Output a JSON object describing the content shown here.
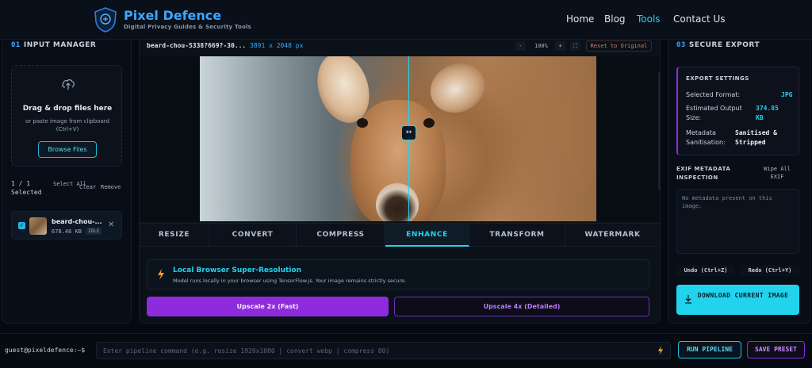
{
  "header": {
    "brand_name": "Pixel Defence",
    "brand_tagline": "Digital Privacy Guides & Security Tools",
    "nav": [
      {
        "label": "Home"
      },
      {
        "label": "Blog"
      },
      {
        "label": "Tools",
        "active": true
      },
      {
        "label": "Contact Us"
      }
    ],
    "accent_color": "#22d3ee",
    "brand_color": "#3aa8ff"
  },
  "input_manager": {
    "number": "01",
    "title": "INPUT MANAGER",
    "dropzone_title": "Drag & drop files here",
    "dropzone_sub": "or paste image from clipboard (Ctrl+V)",
    "browse_label": "Browse Files",
    "selection_count": "1 / 1",
    "selection_label": "Selected",
    "select_all": "Select All",
    "clear": "Clear",
    "remove": "Remove",
    "file": {
      "name": "beard-chou-...",
      "size": "678.46 KB",
      "status": "IDLE"
    }
  },
  "editor": {
    "file_name": "beard-chou-5338?669?-30...",
    "dimensions": "3891 x 2048 px",
    "zoom_out": "-",
    "zoom": "100%",
    "zoom_in": "+",
    "fit": "⛶",
    "reset_label": "Reset to Original",
    "split_handle": "↔",
    "tabs": [
      {
        "label": "RESIZE"
      },
      {
        "label": "CONVERT"
      },
      {
        "label": "COMPRESS"
      },
      {
        "label": "ENHANCE",
        "active": true
      },
      {
        "label": "TRANSFORM"
      },
      {
        "label": "WATERMARK"
      }
    ],
    "enhance": {
      "title": "Local Browser Super-Resolution",
      "description": "Model runs locally in your browser using TensorFlow.js. Your image remains strictly secure.",
      "btn_2x": "Upscale 2x (Fast)",
      "btn_4x": "Upscale 4x (Detailed)"
    }
  },
  "secure_export": {
    "number": "03",
    "title": "SECURE EXPORT",
    "settings_title": "EXPORT SETTINGS",
    "format_label": "Selected Format:",
    "format_value": "JPG",
    "size_label": "Estimated Output Size:",
    "size_value": "374.85 KB",
    "meta_label": "Metadata Sanitisation:",
    "meta_value": "Sanitised & Stripped",
    "exif_title": "EXIF METADATA INSPECTION",
    "wipe_label": "Wipe All EXIF",
    "exif_empty": "No metadata present on this image.",
    "undo_label": "Undo (Ctrl+Z)",
    "redo_label": "Redo (Ctrl+Y)",
    "download_label": "DOWNLOAD CURRENT IMAGE"
  },
  "pipeline": {
    "prompt": "guest@pixeldefence:~$",
    "placeholder": "Enter pipeline command (e.g. resize 1920x1080 | convert webp | compress 80)",
    "run_label": "RUN PIPELINE",
    "save_label": "SAVE PRESET"
  }
}
